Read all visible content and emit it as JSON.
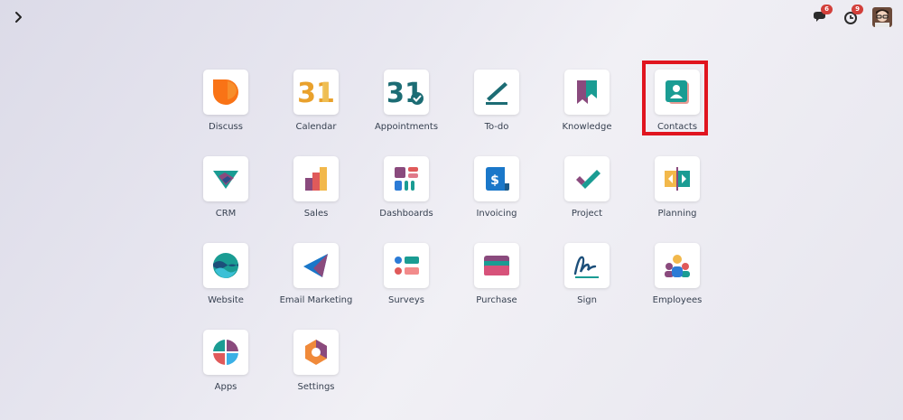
{
  "topbar": {
    "menu_icon": "chevron-right-icon",
    "discuss_count": "6",
    "activity_count": "9"
  },
  "apps": [
    {
      "label": "Discuss",
      "icon": "discuss-icon"
    },
    {
      "label": "Calendar",
      "icon": "calendar-icon",
      "icon_text": "31"
    },
    {
      "label": "Appointments",
      "icon": "appointments-icon",
      "icon_text": "31"
    },
    {
      "label": "To-do",
      "icon": "todo-icon"
    },
    {
      "label": "Knowledge",
      "icon": "knowledge-icon"
    },
    {
      "label": "Contacts",
      "icon": "contacts-icon",
      "highlighted": true
    },
    {
      "label": "CRM",
      "icon": "crm-icon"
    },
    {
      "label": "Sales",
      "icon": "sales-icon"
    },
    {
      "label": "Dashboards",
      "icon": "dashboards-icon"
    },
    {
      "label": "Invoicing",
      "icon": "invoicing-icon",
      "icon_text": "$"
    },
    {
      "label": "Project",
      "icon": "project-icon"
    },
    {
      "label": "Planning",
      "icon": "planning-icon"
    },
    {
      "label": "Website",
      "icon": "website-icon"
    },
    {
      "label": "Email Marketing",
      "icon": "email-marketing-icon"
    },
    {
      "label": "Surveys",
      "icon": "surveys-icon"
    },
    {
      "label": "Purchase",
      "icon": "purchase-icon"
    },
    {
      "label": "Sign",
      "icon": "sign-icon"
    },
    {
      "label": "Employees",
      "icon": "employees-icon"
    },
    {
      "label": "Apps",
      "icon": "apps-icon"
    },
    {
      "label": "Settings",
      "icon": "settings-icon"
    }
  ],
  "colors": {
    "highlight": "#e0151f",
    "badge": "#d23f3a",
    "orange": "#f97316",
    "teal": "#1a9c93",
    "purple": "#8a4a7d",
    "dark_teal": "#1c6c74"
  }
}
